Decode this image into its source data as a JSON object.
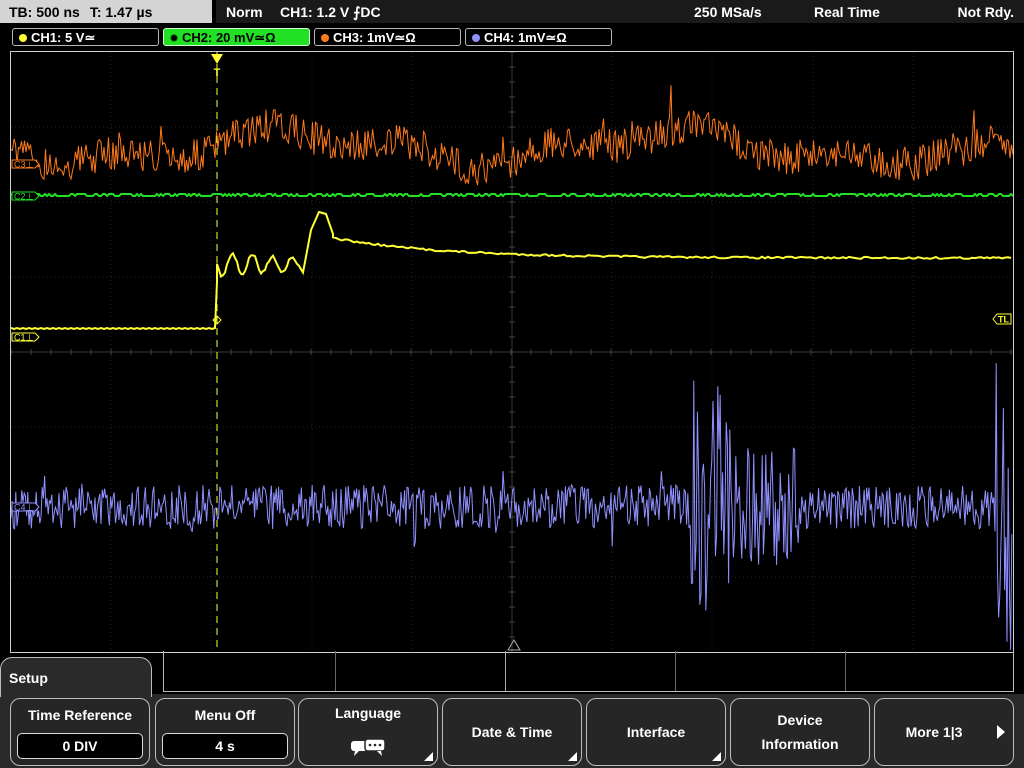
{
  "status": {
    "timebase": "TB: 500 ns",
    "trigger_time": "T: 1.47 µs",
    "mode": "Norm",
    "trigger": "CH1: 1.2 V ⨍DC",
    "sample_rate": "250 MSa/s",
    "acquisition": "Real Time",
    "state": "Not Rdy."
  },
  "channels": [
    {
      "label": "CH1: 5 V≃",
      "color": "#ffff33"
    },
    {
      "label": "CH2: 20 mV≃Ω",
      "color": "#22e024"
    },
    {
      "label": "CH3: 1mV≃Ω",
      "color": "#ff7a1a"
    },
    {
      "label": "CH4: 1mV≃Ω",
      "color": "#9090ff"
    }
  ],
  "markers": {
    "c3": "C3⊥",
    "c2": "C2⊥",
    "c1": "C1⊥",
    "c4": "C4⊥",
    "trigger_level": "TL",
    "trigger_marker": "T"
  },
  "menu": {
    "title": "Setup",
    "softkeys": [
      {
        "label": "Time Reference",
        "value": "0 DIV"
      },
      {
        "label": "Menu Off",
        "value": "4 s"
      },
      {
        "label": "Language",
        "icon": "language-icon"
      },
      {
        "label": "Date & Time"
      },
      {
        "label": "Interface"
      },
      {
        "label": "Device",
        "label2": "Information"
      },
      {
        "label": "More 1|3"
      }
    ]
  }
}
